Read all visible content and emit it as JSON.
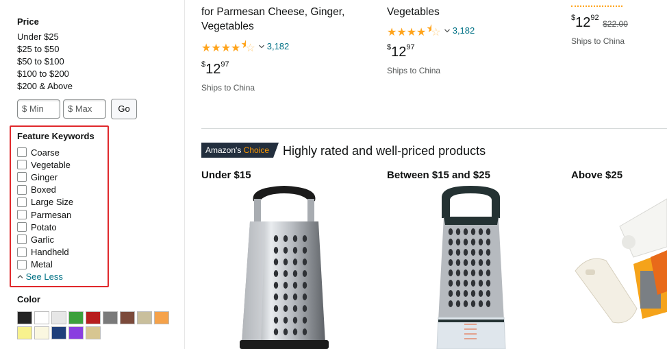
{
  "sidebar": {
    "price": {
      "title": "Price",
      "ranges": [
        "Under $25",
        "$25 to $50",
        "$50 to $100",
        "$100 to $200",
        "$200 & Above"
      ],
      "min_placeholder": "$ Min",
      "max_placeholder": "$ Max",
      "go_label": "Go"
    },
    "feature_keywords": {
      "title": "Feature Keywords",
      "items": [
        "Coarse",
        "Vegetable",
        "Ginger",
        "Boxed",
        "Large Size",
        "Parmesan",
        "Potato",
        "Garlic",
        "Handheld",
        "Metal"
      ],
      "see_less": "See Less",
      "see_less_icon": "chevron-up"
    },
    "color": {
      "title": "Color",
      "swatches": [
        "#232323",
        "#ffffff",
        "#e6e6e6",
        "#3ca03c",
        "#b81e1e",
        "#7a7a7a",
        "#7b4a3b",
        "#c9bf9c",
        "#f5a24a",
        "#f8f28e",
        "#faf7e0",
        "#1f3f7a",
        "#8a3ee0",
        "#d7c691"
      ]
    }
  },
  "products_top": [
    {
      "title": "for Parmesan Cheese, Ginger, Vegetables",
      "rating": "3,182",
      "stars": 4.5,
      "price_whole": "12",
      "price_fraction": "97",
      "ships": "Ships to China"
    },
    {
      "title": "Vegetables",
      "rating": "3,182",
      "stars": 4.5,
      "price_whole": "12",
      "price_fraction": "97",
      "ships": "Ships to China"
    },
    {
      "price_whole": "12",
      "price_fraction": "92",
      "list_price": "$22.00",
      "ships": "Ships to China"
    }
  ],
  "currency": "$",
  "choice": {
    "badge_prefix": "Amazon's ",
    "badge_choice": "Choice",
    "heading": "Highly rated and well-priced products",
    "categories": [
      "Under $15",
      "Between $15 and $25",
      "Above $25"
    ]
  },
  "colors": {
    "link": "#007185",
    "star": "#ffa41c",
    "highlight": "#e0282b",
    "badge_bg": "#232f3e",
    "badge_accent": "#ff9900"
  }
}
